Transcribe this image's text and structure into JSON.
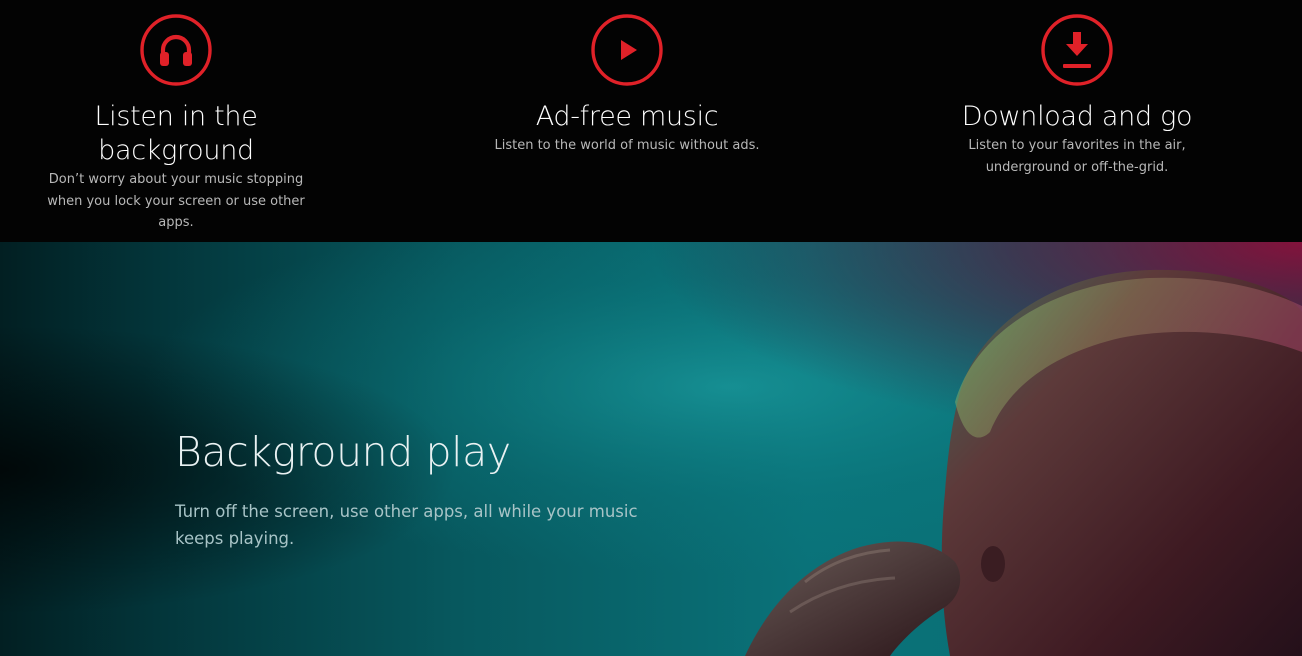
{
  "colors": {
    "accent_red": "#e02128",
    "top_background": "#030303",
    "hero_teal": "#0b7c83",
    "hero_magenta": "#7a1038"
  },
  "features": [
    {
      "icon": "headphones-icon",
      "title_line1": "Listen in the",
      "title_line2": "background",
      "desc_line1": "Don’t worry about your music stopping",
      "desc_line2": "when you lock your screen or use other",
      "desc_line3": "apps."
    },
    {
      "icon": "play-icon",
      "title_line1": "Ad-free music",
      "desc_line1": "Listen to the world of music without ads."
    },
    {
      "icon": "download-icon",
      "title_line1": "Download and go",
      "desc_line1": "Listen to your favorites in the air,",
      "desc_line2": "underground or off-the-grid."
    }
  ],
  "hero": {
    "title": "Background play",
    "desc_line1": "Turn off the screen, use other apps, all while your music",
    "desc_line2": "keeps playing."
  }
}
